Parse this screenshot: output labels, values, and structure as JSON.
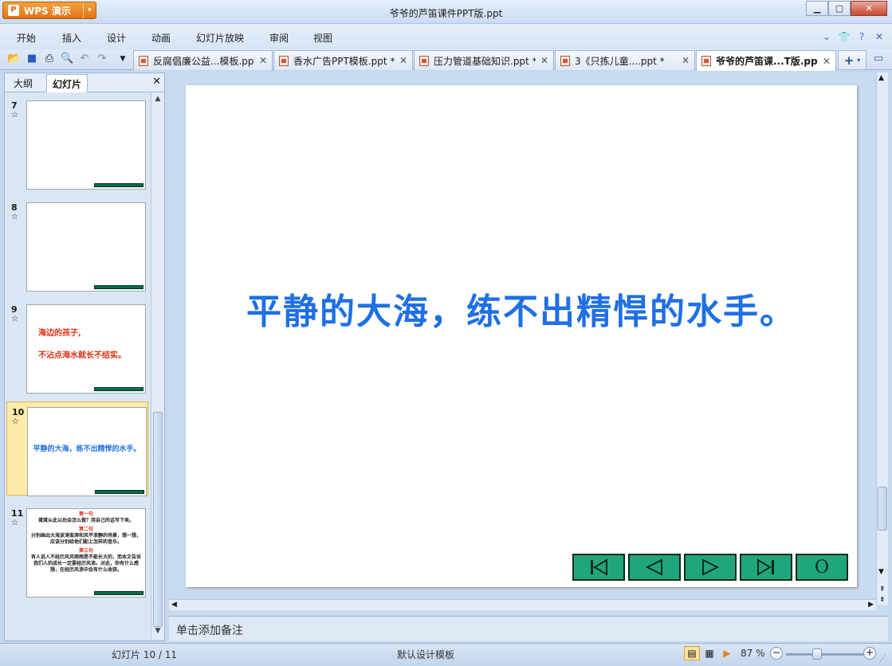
{
  "app": {
    "button_label": "WPS 演示",
    "window_title": "爷爷的芦笛课件PPT版.ppt"
  },
  "menu": [
    "开始",
    "插入",
    "设计",
    "动画",
    "幻灯片放映",
    "审阅",
    "视图"
  ],
  "tabs": [
    {
      "label": "反腐倡廉公益...模板.ppt"
    },
    {
      "label": "香水广告PPT模板.ppt *"
    },
    {
      "label": "压力管道基础知识.ppt *"
    },
    {
      "label": "3《只拣儿童....ppt *"
    },
    {
      "label": "爷爷的芦笛课...T版.ppt"
    }
  ],
  "pane": {
    "tab_outline": "大纲",
    "tab_slides": "幻灯片"
  },
  "thumbnails": [
    {
      "num": "7"
    },
    {
      "num": "8"
    },
    {
      "num": "9",
      "line1": "海边的孩子,",
      "line2": "不沾点海水就长不结实。"
    },
    {
      "num": "10",
      "text": "平静的大海，练不出精悍的水手。"
    },
    {
      "num": "11",
      "h1": "第一句",
      "p1": "蛋蛋从此以后会怎么做？用自己的话写下来。",
      "h2": "第二句",
      "p2": "分别画出大海波涛澎湃和风平浪静的场景，想一想，应该分别给他们配上怎样的音乐。",
      "h3": "第三句",
      "p3": "有人说人不经历风风雨雨是不能长大的，而本文告诉我们人的成长一定要经历风浪。对此，你有什么感想，在经历风浪中会有什么收获。"
    }
  ],
  "slide": {
    "text": "平静的大海，练不出精悍的水手。"
  },
  "nav_buttons": [
    "first",
    "prev",
    "next",
    "last",
    "O"
  ],
  "notes": {
    "placeholder": "单击添加备注"
  },
  "status": {
    "slide_counter": "幻灯片 10 / 11",
    "template": "默认设计模板",
    "zoom": "87 %"
  },
  "colors": {
    "slide_text": "#1f6fe6",
    "nav_button": "#20a67c",
    "thumb_red": "#e03010"
  }
}
